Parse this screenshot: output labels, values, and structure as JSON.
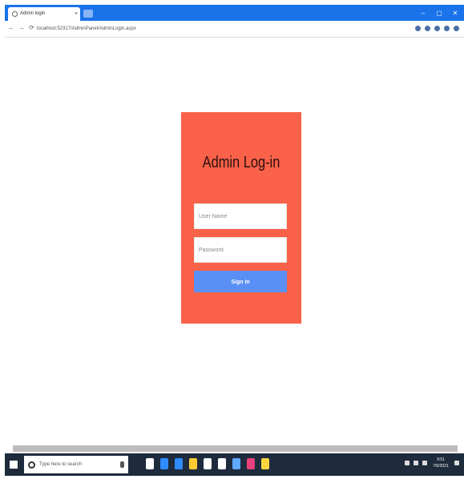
{
  "browser": {
    "tab_title": "Admin login",
    "tab_close": "×",
    "url": "localhost:52317/AdminPanel/AdminLogin.aspx",
    "window_controls": [
      "–",
      "▢",
      "✕"
    ],
    "nav": {
      "back": "←",
      "forward": "→",
      "reload": "⟳"
    }
  },
  "login": {
    "title": "Admin Log-in",
    "username_placeholder": "User Name",
    "password_placeholder": "Password",
    "signin_label": "Sign In"
  },
  "taskbar": {
    "search_placeholder": "Type here to search",
    "time": "9:51",
    "date": "7/6/2021",
    "app_icon_colors": [
      "#ffffff",
      "#2f8cff",
      "#2f8cff",
      "#ffcc33",
      "#ffffff",
      "#ffffff",
      "#5fa8ff",
      "#e8417b",
      "#ffd640"
    ]
  },
  "colors": {
    "browser_chrome": "#1a73e8",
    "card_background": "#f96248",
    "signin_button": "#5a8ff5",
    "taskbar": "#1e2b3c"
  }
}
